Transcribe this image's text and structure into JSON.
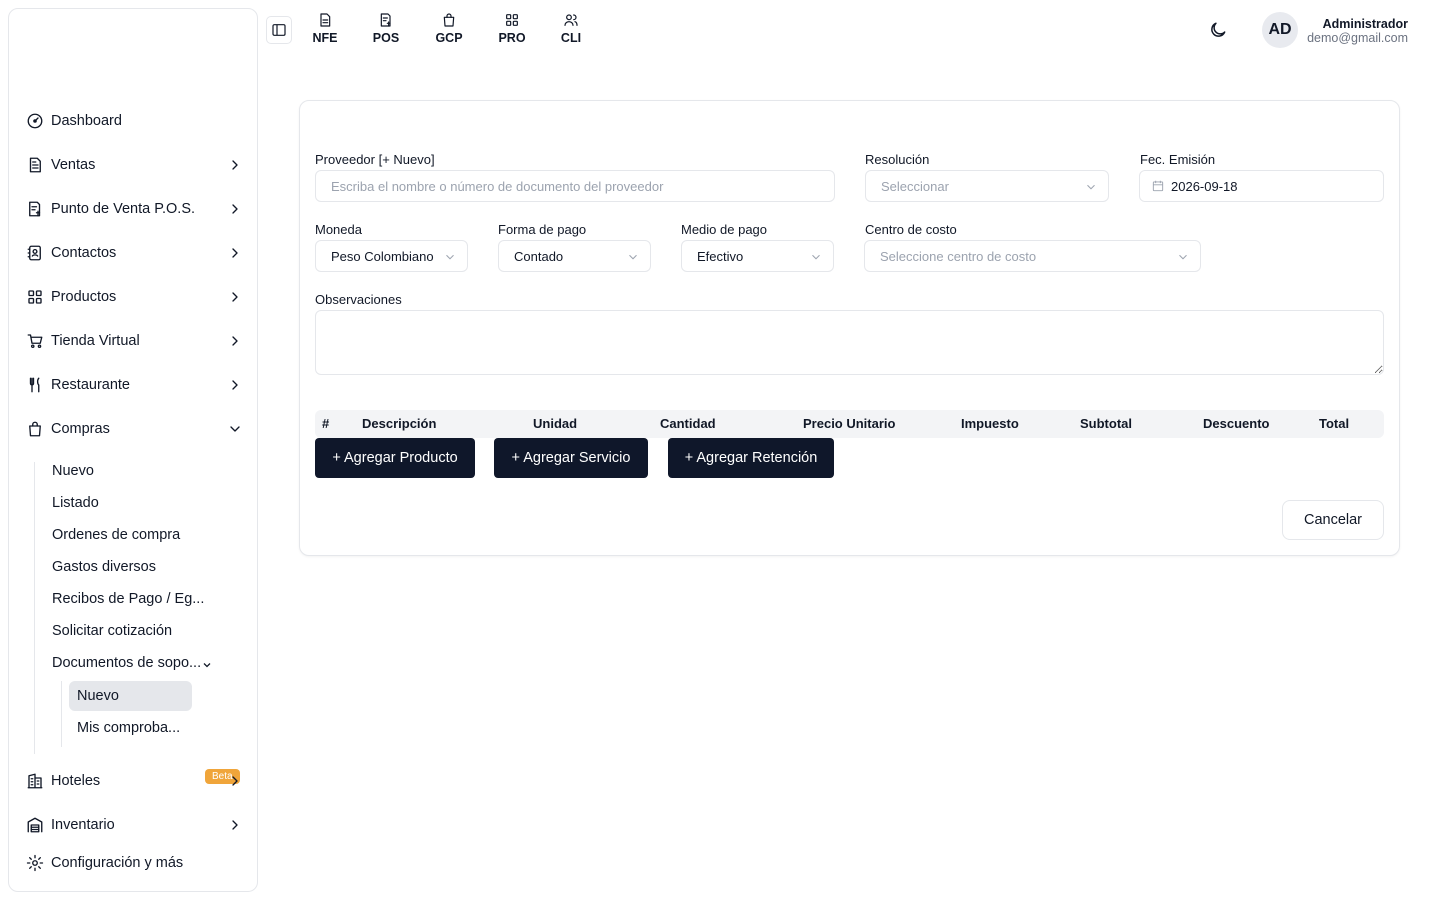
{
  "sidebar": {
    "items": [
      {
        "label": "Dashboard"
      },
      {
        "label": "Ventas"
      },
      {
        "label": "Punto de Venta P.O.S."
      },
      {
        "label": "Contactos"
      },
      {
        "label": "Productos"
      },
      {
        "label": "Tienda Virtual"
      },
      {
        "label": "Restaurante"
      },
      {
        "label": "Compras"
      }
    ],
    "compras_sub": [
      {
        "label": "Nuevo"
      },
      {
        "label": "Listado"
      },
      {
        "label": "Ordenes de compra"
      },
      {
        "label": "Gastos diversos"
      },
      {
        "label": "Recibos de Pago / Eg..."
      },
      {
        "label": "Solicitar cotización"
      },
      {
        "label": "Documentos de sopo..."
      }
    ],
    "documentos_sub": [
      {
        "label": "Nuevo"
      },
      {
        "label": "Mis comproba..."
      }
    ],
    "hoteles": {
      "label": "Hoteles",
      "badge": "Beta"
    },
    "inventario": {
      "label": "Inventario"
    },
    "configuracion": {
      "label": "Configuración y más"
    }
  },
  "topbar": {
    "apps": [
      {
        "label": "NFE",
        "icon": "document-icon"
      },
      {
        "label": "POS",
        "icon": "receipt-icon"
      },
      {
        "label": "GCP",
        "icon": "bag-icon"
      },
      {
        "label": "PRO",
        "icon": "grid-icon"
      },
      {
        "label": "CLI",
        "icon": "users-icon"
      }
    ],
    "user": {
      "initials": "AD",
      "name": "Administrador",
      "email": "demo@gmail.com"
    }
  },
  "form": {
    "proveedor": {
      "label": "Proveedor [+ Nuevo]",
      "placeholder": "Escriba el nombre o número de documento del proveedor"
    },
    "resolucion": {
      "label": "Resolución",
      "placeholder": "Seleccionar"
    },
    "fecha": {
      "label": "Fec. Emisión",
      "value": "2026-09-18"
    },
    "moneda": {
      "label": "Moneda",
      "value": "Peso Colombiano"
    },
    "forma_pago": {
      "label": "Forma de pago",
      "value": "Contado"
    },
    "medio_pago": {
      "label": "Medio de pago",
      "value": "Efectivo"
    },
    "centro_costo": {
      "label": "Centro de costo",
      "placeholder": "Seleccione centro de costo"
    },
    "observaciones": {
      "label": "Observaciones"
    }
  },
  "table": {
    "columns": [
      "#",
      "Descripción",
      "Unidad",
      "Cantidad",
      "Precio Unitario",
      "Impuesto",
      "Subtotal",
      "Descuento",
      "Total"
    ]
  },
  "actions": {
    "agregar_producto": "+ Agregar Producto",
    "agregar_servicio": "+ Agregar Servicio",
    "agregar_retencion": "+ Agregar Retención",
    "cancelar": "Cancelar"
  }
}
